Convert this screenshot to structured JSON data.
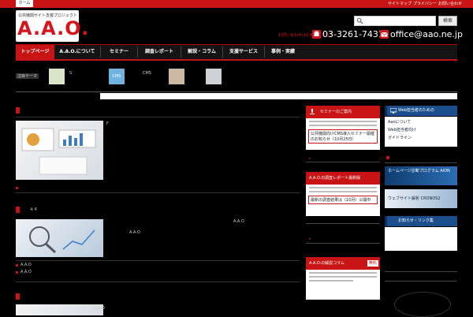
{
  "topbar": {
    "home_tab": "ホーム",
    "links": [
      "サイトマップ",
      "プライバシー",
      "お問い合わせ"
    ]
  },
  "header": {
    "logo_subtitle": "公共機関サイト支援プロジェクト",
    "logo_text": "A.A.O.",
    "search_placeholder": "",
    "search_button": "検索",
    "contact_label": "お問い合わせはお気軽にどうぞ",
    "phone": "03-3261-7431",
    "email": "office@aao.ne.jp"
  },
  "nav": {
    "items": [
      "トップページ",
      "A.A.O.について",
      "セミナー",
      "調査レポート",
      "解説・コラム",
      "支援サービス",
      "事例・実績"
    ]
  },
  "ticker": {
    "label": "注目テーマ",
    "items": [
      "S",
      "CMS",
      "CMS",
      "",
      ""
    ]
  },
  "main": {
    "article1": {
      "tag": "F"
    },
    "article2": {
      "title": "※ 6",
      "meta": "A.A.O"
    },
    "article3": {
      "meta": "A.A.O"
    }
  },
  "mid_sidebar": {
    "panel1": {
      "title": "セミナーのご案内",
      "item": "公共機関向けCMS導入セミナー開催のお知らせ（10月25日）"
    },
    "panel2": {
      "title": "A.A.O.の調査レポート最新版",
      "item": "最新の調査結果は（10月）公開中"
    },
    "panel3": {
      "title": "A.A.O.の解説コラム",
      "badge": "無料"
    }
  },
  "right_sidebar": {
    "header1": "Web担当者のための",
    "box1_items": [
      "Aaoについて",
      "Web担当者向け",
      "ガイドライン"
    ],
    "banner1": "ホームページ診断プログラム AION",
    "banner2": "ウェブサイト解析 CRONOS2",
    "header2": "お知らせ・リンク集"
  },
  "colors": {
    "brand_red": "#c81414",
    "nav_blue": "#1a4e8c",
    "background": "#000000"
  }
}
